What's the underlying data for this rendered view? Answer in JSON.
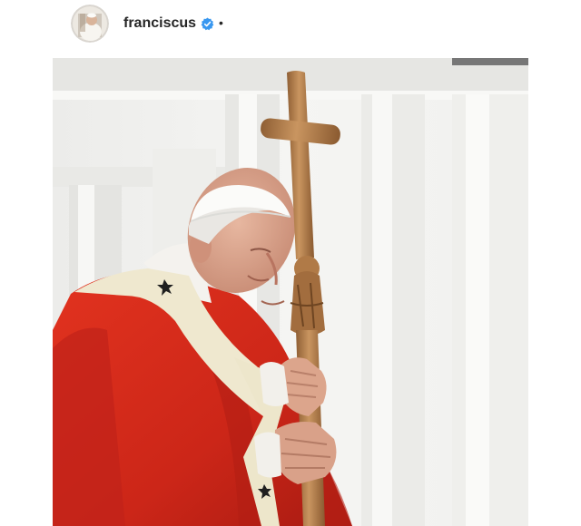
{
  "post": {
    "username": "franciscus",
    "separator": "•",
    "avatar_icon": "profile-photo",
    "verified_icon": "verified-badge-icon",
    "verified_color": "#3897f0"
  },
  "photo": {
    "description_icon": "photo-pope-with-crosier",
    "colors": {
      "vestment_red": "#d5281b",
      "background_white": "#f3f3f1",
      "staff_wood": "#b88553",
      "stole_cream": "#eee7cd"
    }
  }
}
